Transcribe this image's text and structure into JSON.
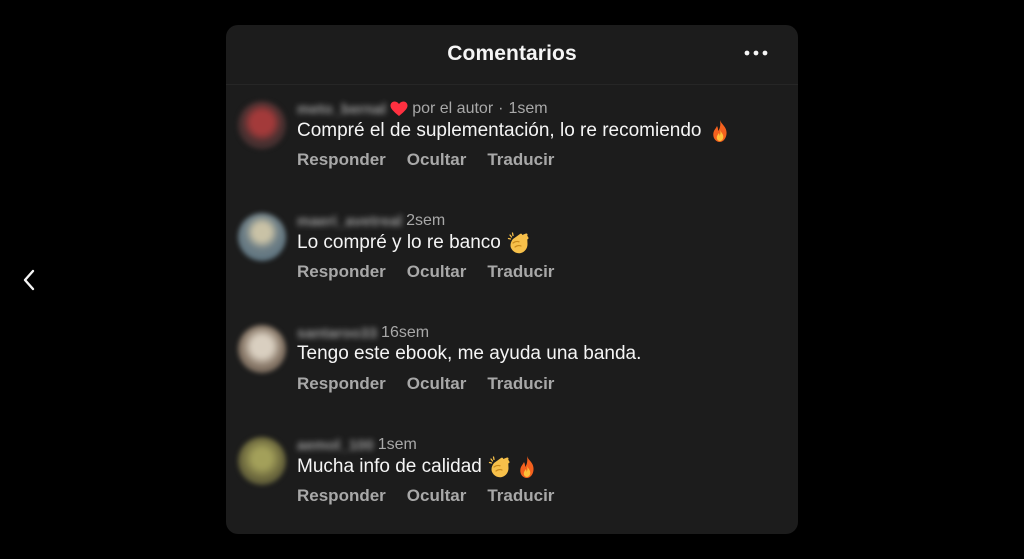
{
  "panel": {
    "title": "Comentarios"
  },
  "comments": [
    {
      "username": "meto_bernal",
      "author_badge": "por el autor",
      "separator": "·",
      "time": "1sem",
      "text": "Compré el de suplementación, lo re recomiendo",
      "emojis": [
        "fire-emoji"
      ],
      "actions": [
        "Responder",
        "Ocultar",
        "Traducir"
      ],
      "avatar_color": "#7a3b3b"
    },
    {
      "username": "maeri_avetreal",
      "time": "2sem",
      "text": "Lo compré y lo re banco",
      "emojis": [
        "clapping-hands-emoji"
      ],
      "actions": [
        "Responder",
        "Ocultar",
        "Traducir"
      ],
      "avatar_color": "#6f7f86"
    },
    {
      "username": "santaroo33",
      "time": "16sem",
      "text": "Tengo este ebook, me ayuda una banda.",
      "emojis": [],
      "actions": [
        "Responder",
        "Ocultar",
        "Traducir"
      ],
      "avatar_color": "#8a7a6a"
    },
    {
      "username": "aemol_100",
      "time": "1sem",
      "text": "Mucha info de calidad",
      "emojis": [
        "clapping-hands-emoji",
        "fire-emoji"
      ],
      "actions": [
        "Responder",
        "Ocultar",
        "Traducir"
      ],
      "avatar_color": "#6e6a3e"
    }
  ],
  "icons": {
    "back": "chevron-left-icon",
    "more": "more-horizontal-icon",
    "heart": "heart-icon"
  },
  "colors": {
    "background": "#000000",
    "panel": "#1c1c1c",
    "text_primary": "#f5f5f5",
    "text_secondary": "#a8a8a8",
    "heart": "#ff3040"
  }
}
